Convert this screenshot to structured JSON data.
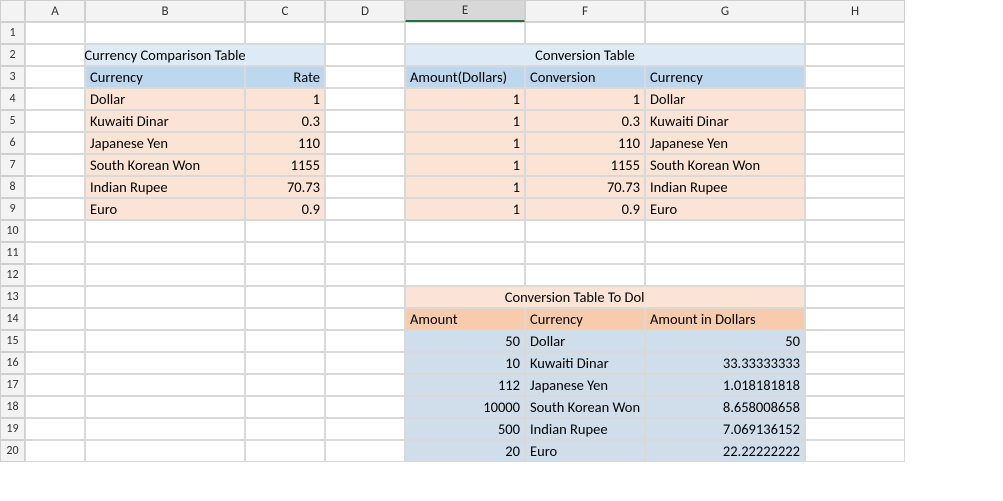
{
  "columns": [
    "A",
    "B",
    "C",
    "D",
    "E",
    "F",
    "G",
    "H"
  ],
  "selected_column": "E",
  "row_count": 20,
  "table1": {
    "title": "Currency Comparison Table",
    "headers": {
      "currency": "Currency",
      "rate": "Rate"
    },
    "rows": [
      {
        "currency": "Dollar",
        "rate": "1"
      },
      {
        "currency": "Kuwaiti Dinar",
        "rate": "0.3"
      },
      {
        "currency": "Japanese Yen",
        "rate": "110"
      },
      {
        "currency": "South Korean Won",
        "rate": "1155"
      },
      {
        "currency": "Indian Rupee",
        "rate": "70.73"
      },
      {
        "currency": "Euro",
        "rate": "0.9"
      }
    ]
  },
  "table2": {
    "title": "Conversion Table",
    "headers": {
      "amount": "Amount(Dollars)",
      "conversion": "Conversion",
      "currency": "Currency"
    },
    "rows": [
      {
        "amount": "1",
        "conversion": "1",
        "currency": "Dollar"
      },
      {
        "amount": "1",
        "conversion": "0.3",
        "currency": "Kuwaiti Dinar"
      },
      {
        "amount": "1",
        "conversion": "110",
        "currency": "Japanese Yen"
      },
      {
        "amount": "1",
        "conversion": "1155",
        "currency": "South Korean Won"
      },
      {
        "amount": "1",
        "conversion": "70.73",
        "currency": "Indian Rupee"
      },
      {
        "amount": "1",
        "conversion": "0.9",
        "currency": "Euro"
      }
    ]
  },
  "table3": {
    "title": "Conversion Table To Dollars",
    "headers": {
      "amount": "Amount",
      "currency": "Currency",
      "dollars": "Amount in Dollars"
    },
    "rows": [
      {
        "amount": "50",
        "currency": "Dollar",
        "dollars": "50"
      },
      {
        "amount": "10",
        "currency": "Kuwaiti Dinar",
        "dollars": "33.33333333"
      },
      {
        "amount": "112",
        "currency": "Japanese Yen",
        "dollars": "1.018181818"
      },
      {
        "amount": "10000",
        "currency": "South Korean Won",
        "dollars": "8.658008658"
      },
      {
        "amount": "500",
        "currency": "Indian Rupee",
        "dollars": "7.069136152"
      },
      {
        "amount": "20",
        "currency": "Euro",
        "dollars": "22.22222222"
      }
    ]
  }
}
